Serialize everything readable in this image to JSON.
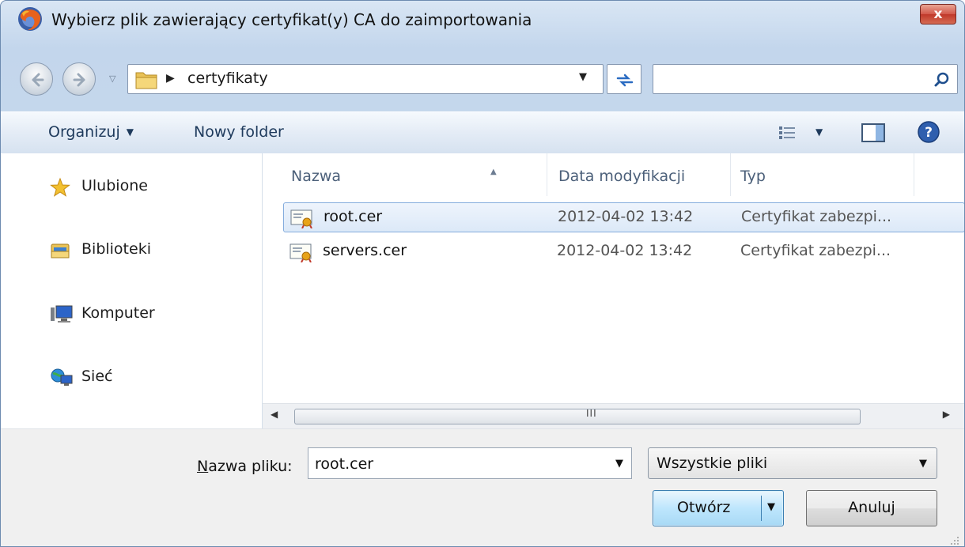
{
  "window": {
    "title": "Wybierz plik zawierający certyfikat(y) CA do zaimportowania",
    "close_label": "x"
  },
  "address": {
    "breadcrumb": "certyfikaty",
    "search_placeholder": ""
  },
  "toolbar": {
    "organize_label": "Organizuj",
    "new_folder_label": "Nowy folder"
  },
  "nav": {
    "items": [
      {
        "label": "Ulubione",
        "icon": "star-icon"
      },
      {
        "label": "Biblioteki",
        "icon": "libraries-icon"
      },
      {
        "label": "Komputer",
        "icon": "computer-icon"
      },
      {
        "label": "Sieć",
        "icon": "network-icon"
      }
    ]
  },
  "filelist": {
    "columns": [
      "Nazwa",
      "Data modyfikacji",
      "Typ"
    ],
    "rows": [
      {
        "name": "root.cer",
        "date": "2012-04-02 13:42",
        "type": "Certyfikat zabezpi...",
        "selected": true
      },
      {
        "name": "servers.cer",
        "date": "2012-04-02 13:42",
        "type": "Certyfikat zabezpi...",
        "selected": false
      }
    ],
    "scroll_grip": "III"
  },
  "footer": {
    "filename_label_prefix": "N",
    "filename_label_rest": "azwa pliku:",
    "filename_value": "root.cer",
    "filter_value": "Wszystkie pliki",
    "open_label": "Otwórz",
    "cancel_label": "Anuluj"
  },
  "colors": {
    "accent": "#84acdd",
    "close": "#c0392b"
  }
}
